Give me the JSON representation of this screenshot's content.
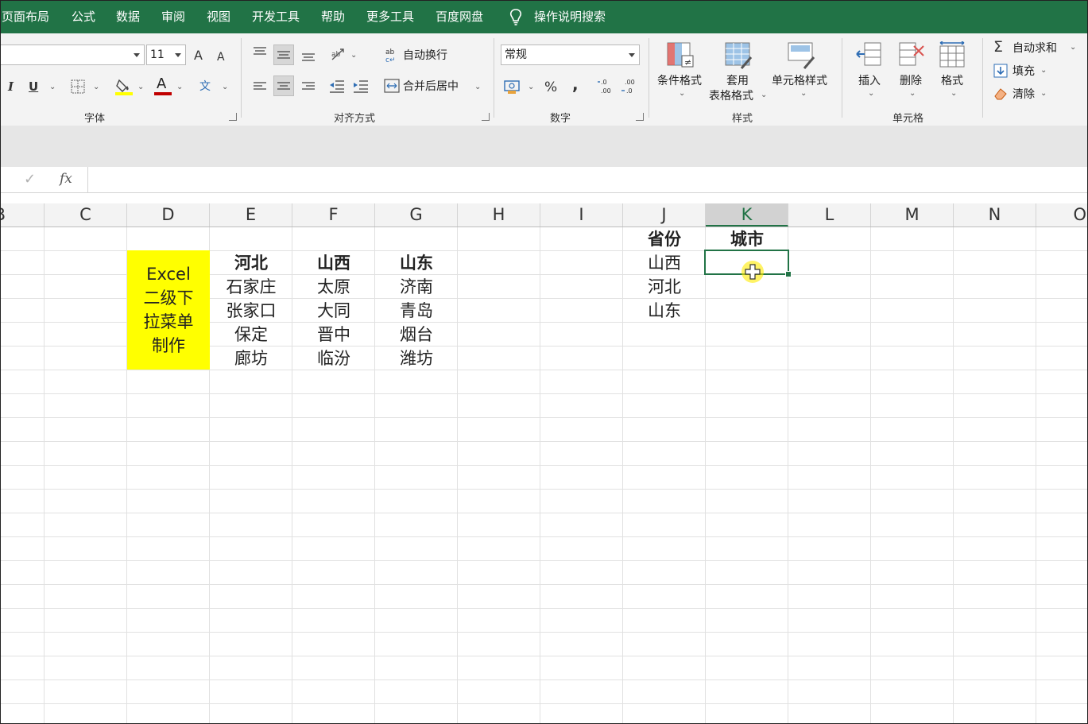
{
  "menu": {
    "items": [
      "页面布局",
      "公式",
      "数据",
      "审阅",
      "视图",
      "开发工具",
      "帮助",
      "更多工具",
      "百度网盘"
    ],
    "search_label": "操作说明搜索"
  },
  "ribbon": {
    "font_group": {
      "label": "字体",
      "font_name": "",
      "font_size": "11",
      "grow_glyph": "A",
      "shrink_glyph": "A",
      "italic_glyph": "I",
      "underline_glyph": "U",
      "font_color_glyph": "A",
      "phonetic_glyph": "文"
    },
    "align_group": {
      "label": "对齐方式",
      "wrap_text": "自动换行",
      "merge_center": "合并后居中"
    },
    "number_group": {
      "label": "数字",
      "format": "常规",
      "percent": "%",
      "comma": ","
    },
    "styles_group": {
      "label": "样式",
      "conditional": "条件格式",
      "table_format_line1": "套用",
      "table_format_line2": "表格格式",
      "cell_styles": "单元格样式"
    },
    "cells_group": {
      "label": "单元格",
      "insert": "插入",
      "delete": "删除",
      "format": "格式"
    },
    "editing_group": {
      "autosum": "自动求和",
      "fill": "填充",
      "clear": "清除"
    }
  },
  "formula_bar": {
    "check": "✓",
    "fx": "fx",
    "value": ""
  },
  "columns": [
    "B",
    "C",
    "D",
    "E",
    "F",
    "G",
    "H",
    "I",
    "J",
    "K",
    "L",
    "M",
    "N",
    "O"
  ],
  "selected_column": "K",
  "cells": {
    "title_lines": [
      "Excel",
      "二级下",
      "拉菜单",
      "制作"
    ],
    "provinces_header": [
      "河北",
      "山西",
      "山东"
    ],
    "hebei": [
      "石家庄",
      "张家口",
      "保定",
      "廊坊"
    ],
    "shanxi": [
      "太原",
      "大同",
      "晋中",
      "临汾"
    ],
    "shandong": [
      "济南",
      "青岛",
      "烟台",
      "潍坊"
    ],
    "j_header": "省份",
    "k_header": "城市",
    "j_values": [
      "山西",
      "河北",
      "山东"
    ]
  },
  "colors": {
    "accent": "#217346",
    "highlight": "#ffff00"
  }
}
